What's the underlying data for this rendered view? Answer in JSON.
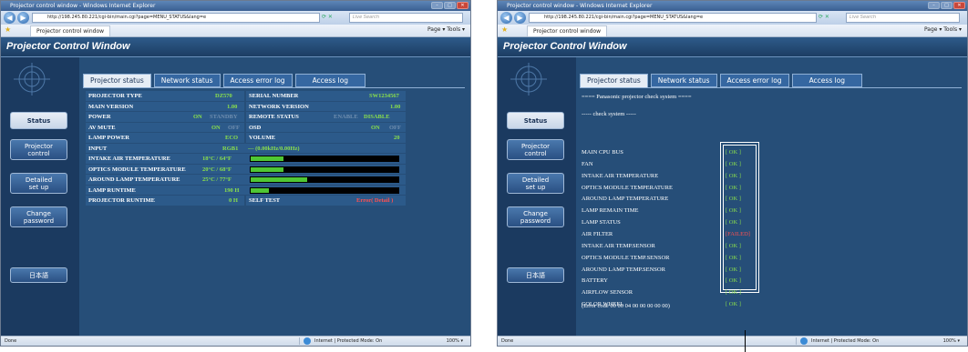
{
  "window_title": "Projector control window - Windows Internet Explorer",
  "url": "http://198.245.80.221/cgi-bin/main.cgi?page=MENU_STATUS&lang=e",
  "search_placeholder": "Live Search",
  "tab_label": "Projector control window",
  "toolbar_right": "Page ▾  Tools ▾",
  "page_title": "Projector Control Window",
  "sidebar": {
    "status": "Status",
    "projector_control": "Projector\ncontrol",
    "detailed_setup": "Detailed\nset up",
    "change_password": "Change\npassword",
    "language": "日本語"
  },
  "tabs": {
    "projector_status": "Projector status",
    "network_status": "Network status",
    "access_error_log": "Access error log",
    "access_log": "Access log"
  },
  "status_rows": [
    {
      "l_label": "PROJECTOR TYPE",
      "l_val": "DZ570",
      "r_label": "SERIAL NUMBER",
      "r_val": "SW1234567"
    },
    {
      "l_label": "MAIN VERSION",
      "l_val": "1.00",
      "r_label": "NETWORK VERSION",
      "r_val": "1.00"
    },
    {
      "l_label": "POWER",
      "l_on": "ON",
      "l_off": "STANDBY",
      "r_label": "REMOTE STATUS",
      "r_off": "ENABLE",
      "r_on": "DISABLE"
    },
    {
      "l_label": "AV MUTE",
      "l_on": "ON",
      "l_off": "OFF",
      "r_label": "OSD",
      "r_on": "ON",
      "r_off": "OFF"
    },
    {
      "l_label": "LAMP POWER",
      "l_val": "ECO",
      "r_label": "VOLUME",
      "r_val": "20"
    },
    {
      "l_label": "INPUT",
      "l_val": "RGB1",
      "l_extra": "---  (0.00kHz/0.00Hz)"
    },
    {
      "l_label": "INTAKE AIR TEMPERATURE",
      "l_val": "18°C / 64°F",
      "bar": 0.22
    },
    {
      "l_label": "OPTICS MODULE TEMPERATURE",
      "l_val": "20°C / 68°F",
      "bar": 0.22
    },
    {
      "l_label": "AROUND LAMP TEMPERATURE",
      "l_val": "25°C / 77°F",
      "bar": 0.38
    },
    {
      "l_label": "LAMP RUNTIME",
      "l_val": "190 H",
      "bar": 0.12
    },
    {
      "l_label": "PROJECTOR RUNTIME",
      "l_val": "0 H",
      "r_label": "SELF TEST",
      "r_fail": "Error( Detail )"
    }
  ],
  "check": {
    "header": "==== Panasonic projector check system ====",
    "sub": "----- check system -----",
    "items": [
      {
        "label": "MAIN CPU BUS",
        "result": "[ OK ]"
      },
      {
        "label": "FAN",
        "result": "[ OK ]"
      },
      {
        "label": "INTAKE AIR TEMPERATURE",
        "result": "[ OK ]"
      },
      {
        "label": "OPTICS MODULE TEMPERATURE",
        "result": "[ OK ]"
      },
      {
        "label": "AROUND LAMP TEMPERATURE",
        "result": "[ OK ]"
      },
      {
        "label": "LAMP REMAIN TIME",
        "result": "[ OK ]"
      },
      {
        "label": "LAMP STATUS",
        "result": "[ OK ]"
      },
      {
        "label": "AIR FILTER",
        "result": "[FAILED]"
      },
      {
        "label": "INTAKE AIR TEMP.SENSOR",
        "result": "[ OK ]"
      },
      {
        "label": "OPTICS MODULE TEMP.SENSOR",
        "result": "[ OK ]"
      },
      {
        "label": "AROUND LAMP TEMP.SENSOR",
        "result": "[ OK ]"
      },
      {
        "label": "BATTERY",
        "result": "[ OK ]"
      },
      {
        "label": "AIRFLOW SENSOR",
        "result": "[ OK ]"
      },
      {
        "label": "COLOR WHEEL",
        "result": "[ OK ]"
      }
    ],
    "error_code": "(Error code 00 00 04 00 00 00 00 00)"
  },
  "statusbar": {
    "done": "Done",
    "zone": "Internet | Protected Mode: On",
    "zoom": "100%  ▾"
  },
  "colors": {
    "accent_on": "#8adf4c",
    "failed": "#ff5050",
    "panel": "#264e78"
  }
}
